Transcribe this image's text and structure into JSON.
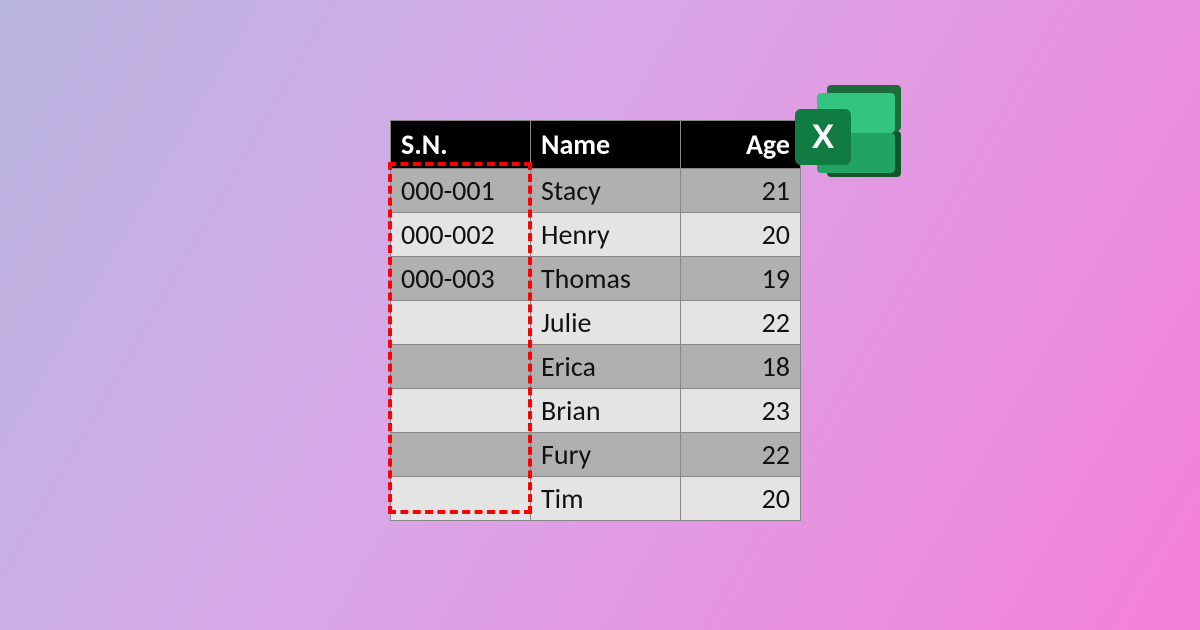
{
  "columns": {
    "sn": "S.N.",
    "name": "Name",
    "age": "Age"
  },
  "rows": [
    {
      "sn": "000-001",
      "name": "Stacy",
      "age": "21"
    },
    {
      "sn": "000-002",
      "name": "Henry",
      "age": "20"
    },
    {
      "sn": "000-003",
      "name": "Thomas",
      "age": "19"
    },
    {
      "sn": "",
      "name": "Julie",
      "age": "22"
    },
    {
      "sn": "",
      "name": "Erica",
      "age": "18"
    },
    {
      "sn": "",
      "name": "Brian",
      "age": "23"
    },
    {
      "sn": "",
      "name": "Fury",
      "age": "22"
    },
    {
      "sn": "",
      "name": "Tim",
      "age": "20"
    }
  ],
  "icon": {
    "letter": "X"
  }
}
